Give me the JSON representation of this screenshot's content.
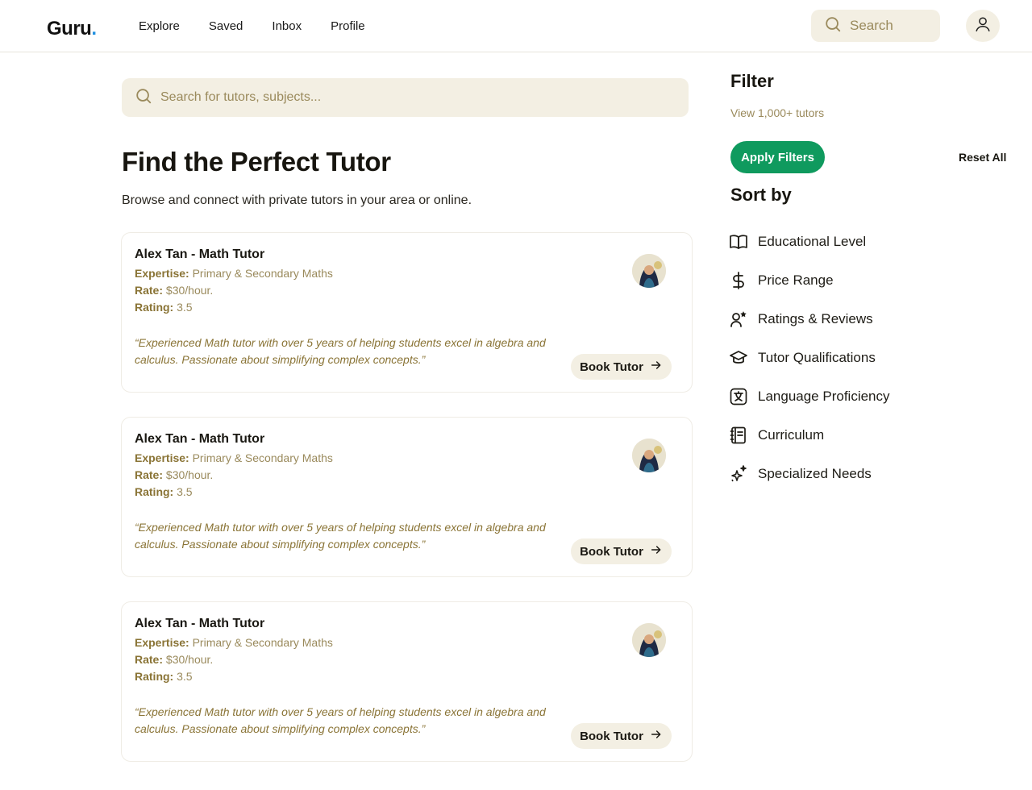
{
  "header": {
    "logo": "Guru",
    "logo_dot": ".",
    "nav": [
      "Explore",
      "Saved",
      "Inbox",
      "Profile"
    ],
    "search_placeholder": "Search"
  },
  "main": {
    "search_placeholder": "Search for tutors, subjects...",
    "title": "Find the Perfect Tutor",
    "subtitle": "Browse and connect with private tutors in your area or online.",
    "tutors": [
      {
        "name": "Alex Tan - Math Tutor",
        "expertise_label": "Expertise:",
        "expertise": "Primary & Secondary Maths",
        "rate_label": "Rate:",
        "rate": "$30/hour.",
        "rating_label": "Rating:",
        "rating": "3.5",
        "quote": "“Experienced Math tutor with over 5 years of helping students excel in algebra and calculus. Passionate about simplifying complex concepts.”",
        "book_label": "Book Tutor"
      },
      {
        "name": "Alex Tan - Math Tutor",
        "expertise_label": "Expertise:",
        "expertise": "Primary & Secondary Maths",
        "rate_label": "Rate:",
        "rate": "$30/hour.",
        "rating_label": "Rating:",
        "rating": "3.5",
        "quote": "“Experienced Math tutor with over 5 years of helping students excel in algebra and calculus. Passionate about simplifying complex concepts.”",
        "book_label": "Book Tutor"
      },
      {
        "name": "Alex Tan - Math Tutor",
        "expertise_label": "Expertise:",
        "expertise": "Primary & Secondary Maths",
        "rate_label": "Rate:",
        "rate": "$30/hour.",
        "rating_label": "Rating:",
        "rating": "3.5",
        "quote": "“Experienced Math tutor with over 5 years of helping students excel in algebra and calculus. Passionate about simplifying complex concepts.”",
        "book_label": "Book Tutor"
      }
    ]
  },
  "sidebar": {
    "filter_title": "Filter",
    "view_link": "View 1,000+ tutors",
    "apply_label": "Apply Filters",
    "reset_label": "Reset All",
    "sort_title": "Sort by",
    "sort_items": [
      {
        "label": "Educational Level",
        "icon": "book-open-icon"
      },
      {
        "label": "Price Range",
        "icon": "dollar-icon"
      },
      {
        "label": "Ratings & Reviews",
        "icon": "user-star-icon"
      },
      {
        "label": "Tutor Qualifications",
        "icon": "graduation-cap-icon"
      },
      {
        "label": "Language Proficiency",
        "icon": "translate-icon"
      },
      {
        "label": "Curriculum",
        "icon": "notebook-icon"
      },
      {
        "label": "Specialized Needs",
        "icon": "sparkles-icon"
      }
    ]
  },
  "colors": {
    "accent_green": "#0f9a5e",
    "gold_text": "#9a8a5c",
    "cream_bg": "#f3efe3",
    "logo_dot": "#1f8fe0"
  }
}
